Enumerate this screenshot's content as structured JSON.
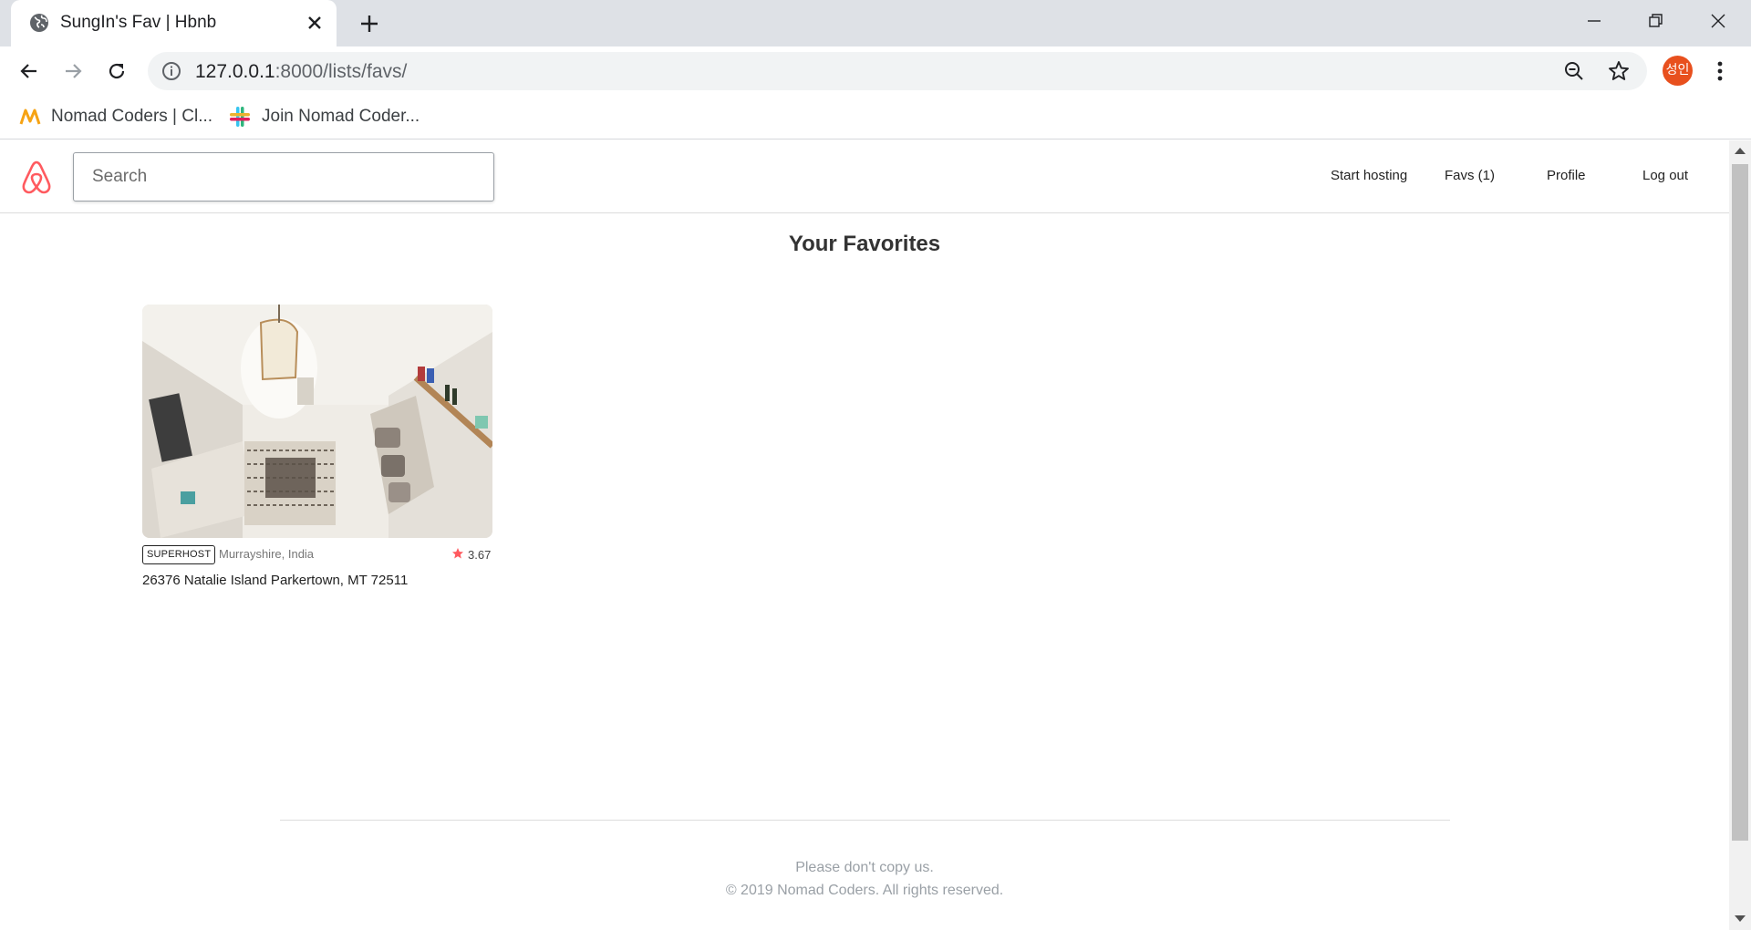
{
  "browser": {
    "tab_title": "SungIn's Fav | Hbnb",
    "url_host": "127.0.0.1",
    "url_path": ":8000/lists/favs/",
    "profile_initials": "성인",
    "profile_color": "#e8501e",
    "bookmarks": [
      {
        "label": "Nomad Coders | Cl...",
        "icon": "nomad-coders-icon"
      },
      {
        "label": "Join Nomad Coder...",
        "icon": "slack-icon"
      }
    ]
  },
  "header": {
    "search_placeholder": "Search",
    "nav": {
      "start_hosting": "Start hosting",
      "favs": "Favs (1)",
      "profile": "Profile",
      "logout": "Log out"
    },
    "brand_color": "#ff5a5f"
  },
  "main": {
    "heading": "Your Favorites",
    "rooms": [
      {
        "badge": "SUPERHOST",
        "city": "Murrayshire, India",
        "rating": "3.67",
        "address": "26376 Natalie Island Parkertown, MT 72511"
      }
    ]
  },
  "footer": {
    "line1": "Please don't copy us.",
    "line2": "© 2019 Nomad Coders. All rights reserved."
  }
}
